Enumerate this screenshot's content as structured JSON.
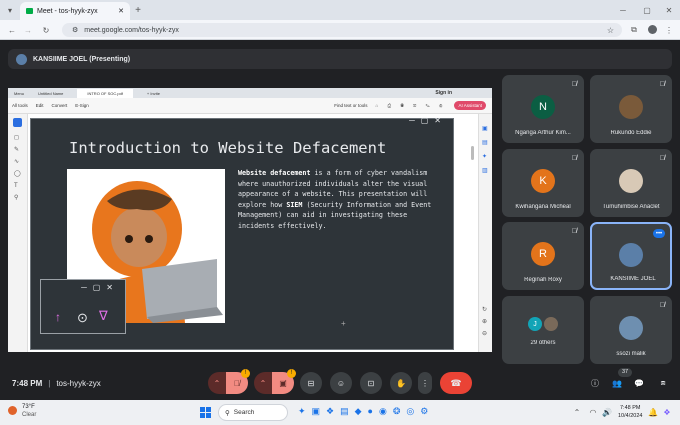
{
  "browser": {
    "tab_title": "Meet - tos-hyyk-zyx",
    "url": "meet.google.com/tos-hyyk-zyx"
  },
  "meet": {
    "presenter_label": "KANSIIME JOEL (Presenting)",
    "time": "7:48 PM",
    "separator": "|",
    "meeting_code": "tos-hyyk-zyx",
    "people_count": "37",
    "badge_count": "!"
  },
  "shared_screen": {
    "tabs": [
      "Menu",
      "Untitled Name",
      "INTRO OF SOC.pdf",
      "+ Invite"
    ],
    "toolbar_items": [
      "All tools",
      "Edit",
      "Convert",
      "E-Sign"
    ],
    "find_label": "Find text or tools",
    "sign_in": "Sign in",
    "ai_label": "AI Assistant",
    "slide": {
      "title": "Introduction to Website Defacement",
      "lead_bold": "Website defacement",
      "body1": " is a form of cyber vandalism where unauthorized individuals alter the visual appearance of a website. This presentation will explore how ",
      "siem_bold": "SIEM",
      "body2": " (Security Information and Event Management) can aid in investigating these incidents effectively."
    }
  },
  "participants": [
    {
      "name": "Nganga Arthur Kim...",
      "initial": "N",
      "color": "#0b5e43"
    },
    {
      "name": "Rukundo Eddie",
      "initial": "",
      "color": "#7a5a3a"
    },
    {
      "name": "Kwihangana Micheal",
      "initial": "K",
      "color": "#e3741b"
    },
    {
      "name": "Tumuhimbise Anaclet",
      "initial": "",
      "color": "#d8c9b6"
    },
    {
      "name": "Reginah Roxy",
      "initial": "R",
      "color": "#e3741b"
    },
    {
      "name": "KANSIIME JOEL",
      "initial": "",
      "color": "#5b7fa8"
    },
    {
      "name": "29 others",
      "initial": "J",
      "color": "#12a4b6"
    },
    {
      "name": "ssozi malik",
      "initial": "",
      "color": "#6e8fb0"
    }
  ],
  "taskbar": {
    "weather_temp": "73°F",
    "weather_text": "Clear",
    "search_placeholder": "Search",
    "clock_time": "7:48 PM",
    "clock_date": "10/4/2024"
  },
  "colors": {
    "accent": "#8ab4f8",
    "leave": "#ea4335",
    "muted": "#f28b82"
  }
}
